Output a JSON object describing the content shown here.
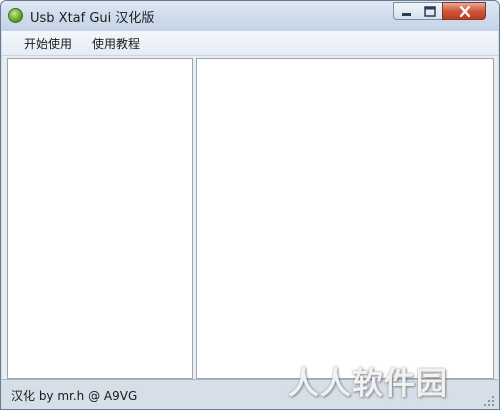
{
  "window": {
    "title": "Usb Xtaf Gui 汉化版",
    "icon": "green-orb-icon",
    "controls": [
      "minimize-icon",
      "maximize-icon",
      "close-icon"
    ]
  },
  "menu": {
    "items": [
      {
        "label": "开始使用"
      },
      {
        "label": "使用教程"
      }
    ]
  },
  "status": {
    "text": "汉化 by mr.h @ A9VG"
  },
  "watermark": {
    "text": "人人软件园"
  },
  "colors": {
    "titlebar": "#cfdcec",
    "menubar": "#eaf0f7",
    "close_button": "#c94a30",
    "statusbar": "#d6dee8",
    "pane_background": "#ffffff"
  }
}
